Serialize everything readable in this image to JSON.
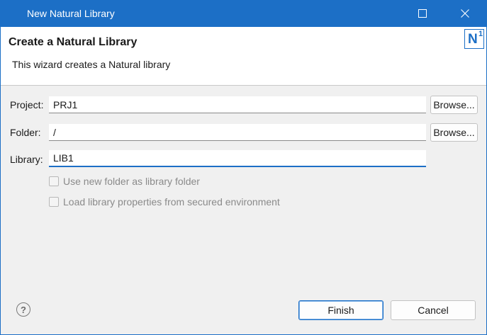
{
  "window": {
    "title": "New Natural Library",
    "accent_color": "#1c6fc6"
  },
  "header": {
    "title": "Create a Natural Library",
    "description": "This wizard creates a Natural library",
    "logo_letter": "N",
    "logo_superscript": "1"
  },
  "form": {
    "project": {
      "label": "Project:",
      "value": "PRJ1",
      "browse_label": "Browse..."
    },
    "folder": {
      "label": "Folder:",
      "value": "/",
      "browse_label": "Browse..."
    },
    "library": {
      "label": "Library:",
      "value": "LIB1"
    },
    "options": [
      {
        "label": "Use new folder as library folder",
        "checked": false,
        "enabled": false
      },
      {
        "label": "Load library properties from secured environment",
        "checked": false,
        "enabled": false
      }
    ]
  },
  "footer": {
    "help_symbol": "?",
    "finish_label": "Finish",
    "cancel_label": "Cancel"
  }
}
